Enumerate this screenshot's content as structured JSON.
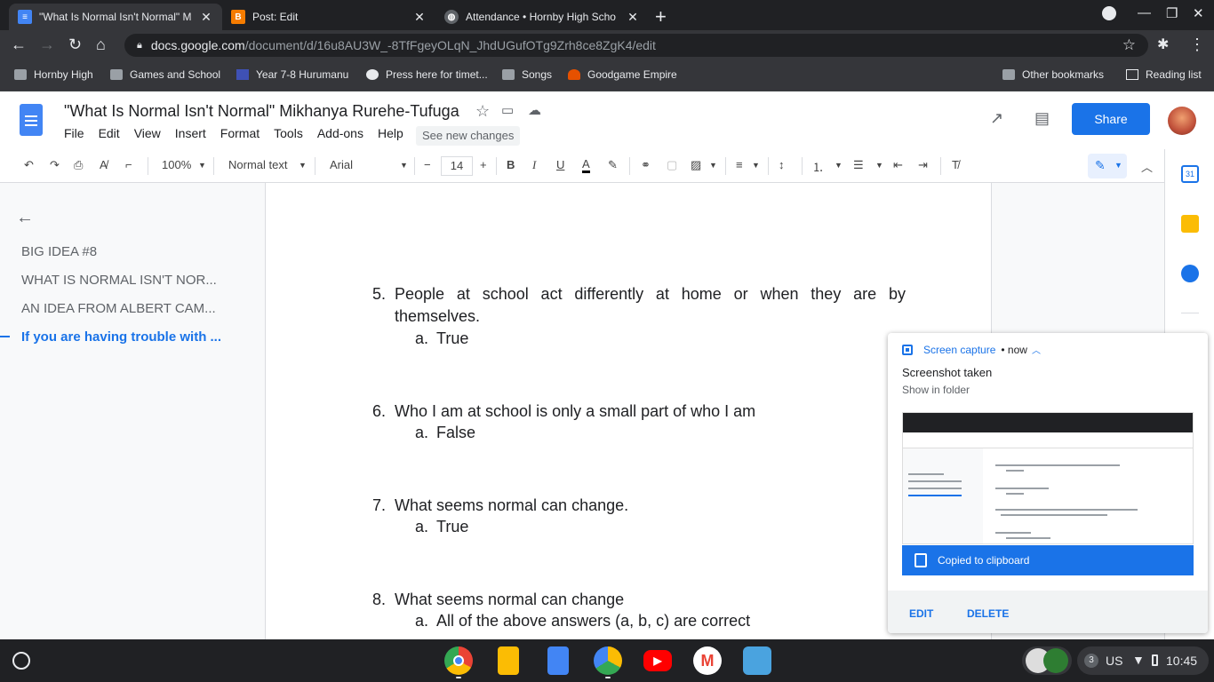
{
  "browser": {
    "tabs": [
      {
        "title": "\"What Is Normal Isn't Normal\" M",
        "icon": "docs-icon",
        "active": true
      },
      {
        "title": "Post: Edit",
        "icon": "blogger-icon",
        "active": false
      },
      {
        "title": "Attendance • Hornby High Scho",
        "icon": "globe-icon",
        "active": false
      }
    ],
    "url_host": "docs.google.com",
    "url_path": "/document/d/16u8AU3W_-8TfFgeyOLqN_JhdUGufOTg9Zrh8ce8ZgK4/edit",
    "bookmarks": [
      {
        "label": "Hornby High",
        "icon": "folder-icon"
      },
      {
        "label": "Games and School",
        "icon": "folder-icon"
      },
      {
        "label": "Year 7-8 Hurumanu",
        "icon": "classroom-icon"
      },
      {
        "label": "Press here for timet...",
        "icon": "globe-icon"
      },
      {
        "label": "Songs",
        "icon": "folder-icon"
      },
      {
        "label": "Goodgame Empire",
        "icon": "game-icon"
      }
    ],
    "bookmarks_right": [
      {
        "label": "Other bookmarks",
        "icon": "folder-icon"
      },
      {
        "label": "Reading list",
        "icon": "reading-list-icon"
      }
    ]
  },
  "docs": {
    "title": "\"What Is Normal Isn't Normal\"  Mikhanya Rurehe-Tufuga",
    "menu": [
      "File",
      "Edit",
      "View",
      "Insert",
      "Format",
      "Tools",
      "Add-ons",
      "Help"
    ],
    "see_new_changes": "See new changes",
    "share_label": "Share",
    "toolbar": {
      "zoom": "100%",
      "style": "Normal text",
      "font": "Arial",
      "font_size": "14"
    }
  },
  "outline": {
    "items": [
      {
        "label": "BIG IDEA #8",
        "active": false
      },
      {
        "label": "WHAT IS NORMAL ISN'T NOR...",
        "active": false
      },
      {
        "label": "AN IDEA FROM ALBERT CAM...",
        "active": false
      },
      {
        "label": "If you are having trouble with ...",
        "active": true
      }
    ]
  },
  "document": {
    "questions": [
      {
        "num": "5.",
        "text": "People at school act differently at home or when they are by themselves.",
        "answer_num": "a.",
        "answer": "True"
      },
      {
        "num": "6.",
        "text": "Who I am at school is only a small part of who I am",
        "answer_num": "a.",
        "answer": "False"
      },
      {
        "num": "7.",
        "text": "What seems normal can change.",
        "answer_num": "a.",
        "answer": "True"
      },
      {
        "num": "8.",
        "text": "What seems normal can change",
        "answer_num": "a.",
        "answer": "All of the above answers (a, b, c) are correct"
      }
    ]
  },
  "notification": {
    "source": "Screen capture",
    "time": "• now",
    "title": "Screenshot taken",
    "subtitle": "Show in folder",
    "copied": "Copied to clipboard",
    "edit_label": "EDIT",
    "delete_label": "DELETE"
  },
  "shelf": {
    "tray_badge": "3",
    "locale": "US",
    "time": "10:45"
  },
  "colors": {
    "accent": "#1a73e8",
    "chrome_dark": "#202124"
  }
}
